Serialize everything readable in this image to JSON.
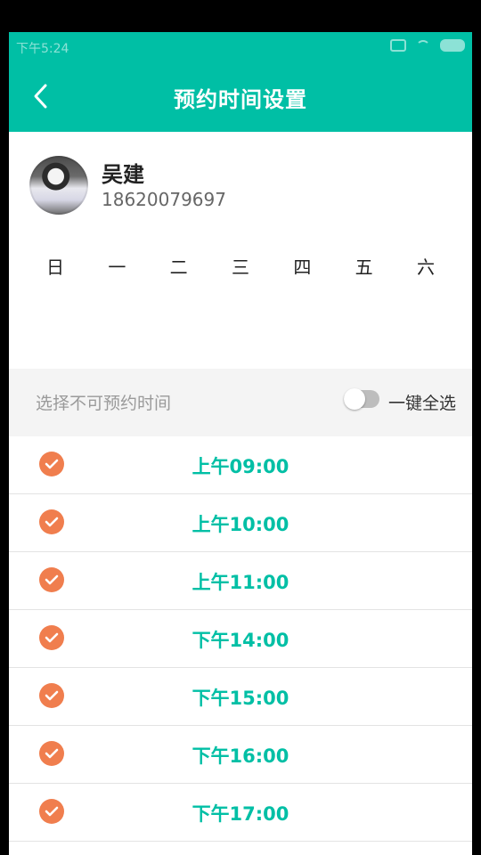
{
  "status_bar": {
    "time": "下午5:24",
    "icons": [
      "sim-icon",
      "wifi-icon",
      "battery-icon"
    ]
  },
  "header": {
    "title": "预约时间设置",
    "back_icon": "back-arrow-icon",
    "background": "#00BFA5"
  },
  "profile": {
    "name": "吴建",
    "phone": "18620079697"
  },
  "weekdays": [
    "日",
    "一",
    "二",
    "三",
    "四",
    "五",
    "六"
  ],
  "selector": {
    "hint": "选择不可预约时间",
    "select_all_label": "一键全选",
    "select_all_on": false
  },
  "slots": [
    {
      "time": "上午09:00",
      "checked": true
    },
    {
      "time": "上午10:00",
      "checked": true
    },
    {
      "time": "上午11:00",
      "checked": true
    },
    {
      "time": "下午14:00",
      "checked": true
    },
    {
      "time": "下午15:00",
      "checked": true
    },
    {
      "time": "下午16:00",
      "checked": true
    },
    {
      "time": "下午17:00",
      "checked": true
    }
  ],
  "colors": {
    "accent": "#00BFA5",
    "check": "#F07E4E"
  }
}
